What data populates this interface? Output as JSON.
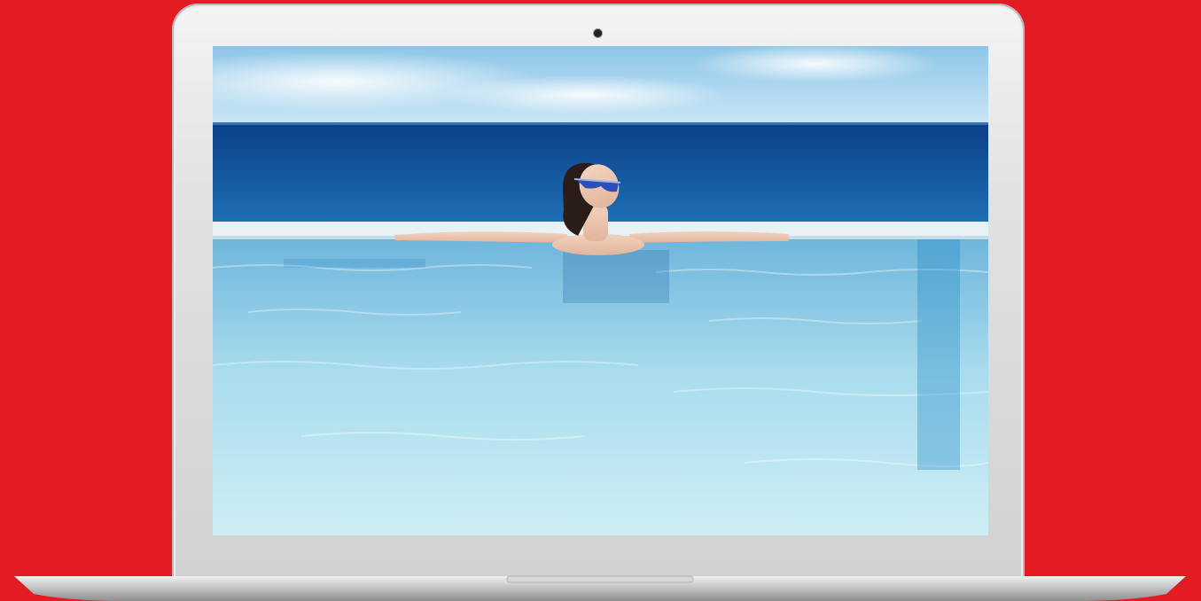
{
  "scene": {
    "background_color": "#e31b23",
    "device": "laptop-computer",
    "screen_subject": "woman-relaxing-in-infinity-pool-overlooking-ocean",
    "colors": {
      "sky_top": "#8ec6e8",
      "sky_bottom": "#c9e6f6",
      "ocean_deep": "#0a3f86",
      "ocean_mid": "#1f6fb5",
      "pool_edge": "#e8f2f5",
      "pool_water_top": "#6fb6dc",
      "pool_water_bottom": "#cdeef4",
      "laptop_silver": "#d6d6d6"
    }
  }
}
